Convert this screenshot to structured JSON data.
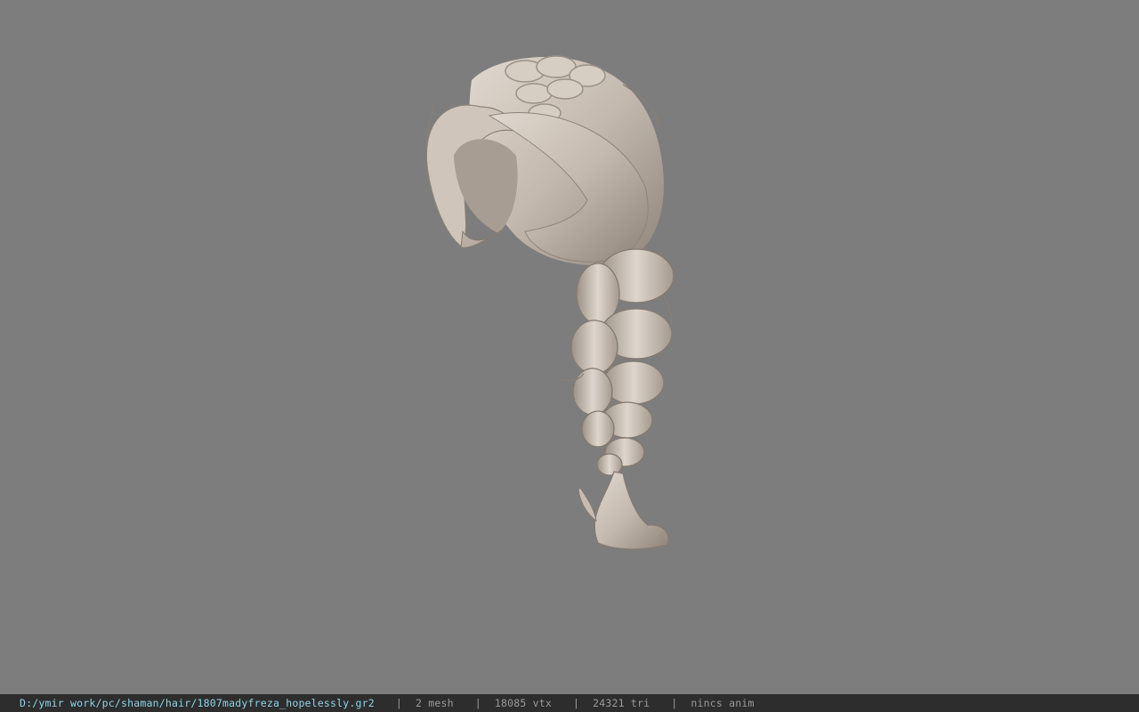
{
  "viewport": {
    "background": "#7d7d7d",
    "model_color": "#c9beb3"
  },
  "statusbar": {
    "file_path": "D:/ymir work/pc/shaman/hair/1807madyfreza_hopelessly.gr2",
    "separator": "|",
    "mesh": "2 mesh",
    "vtx": "18085 vtx",
    "tri": "24321 tri",
    "anim": "nincs anim"
  }
}
